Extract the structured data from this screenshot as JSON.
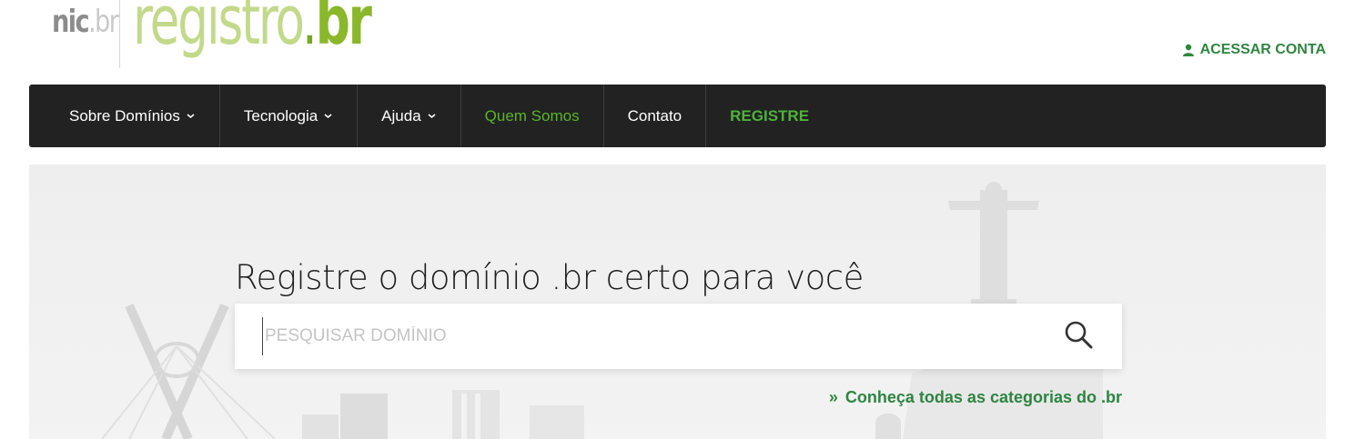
{
  "header": {
    "logo_nic_main": "nic",
    "logo_nic_sub": ".br",
    "logo_registro_main": "registro",
    "logo_registro_dot": ".",
    "logo_registro_br": "br",
    "account_label": "ACESSAR CONTA",
    "account_icon": "user-icon"
  },
  "nav": {
    "items": [
      {
        "label": "Sobre Domínios",
        "has_dropdown": true
      },
      {
        "label": "Tecnologia",
        "has_dropdown": true
      },
      {
        "label": "Ajuda",
        "has_dropdown": true
      },
      {
        "label": "Quem Somos",
        "has_dropdown": false
      },
      {
        "label": "Contato",
        "has_dropdown": false
      },
      {
        "label": "REGISTRE",
        "has_dropdown": false
      }
    ]
  },
  "hero": {
    "title": "Registre o domínio .br certo para você",
    "search_placeholder": "PESQUISAR DOMÍNIO",
    "search_value": "",
    "search_icon": "search-icon",
    "categories_prefix": "»",
    "categories_link": "Conheça todas as categorias do .br"
  },
  "colors": {
    "brand_green": "#2e8540",
    "nav_bg": "#222222",
    "registre_green": "#4fb33a",
    "logo_light_green": "#c3d98a"
  }
}
